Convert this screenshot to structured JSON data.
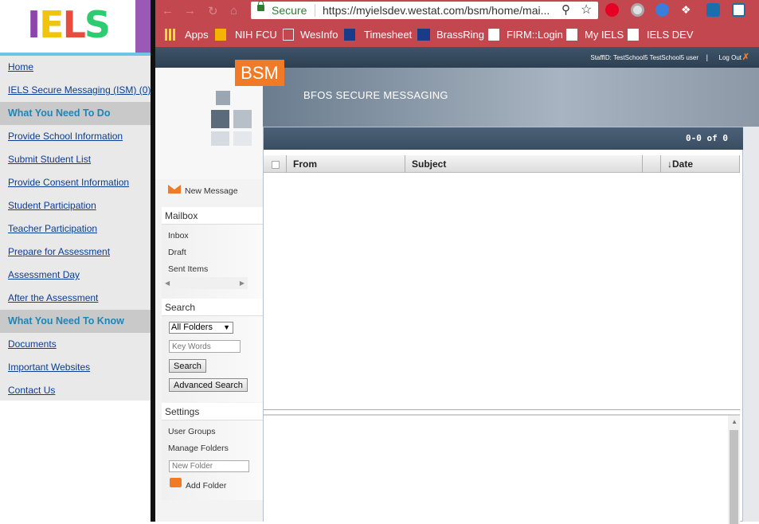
{
  "iels": {
    "logo": "IELS",
    "nav": [
      {
        "type": "link",
        "label": "Home"
      },
      {
        "type": "link",
        "label": "IELS Secure Messaging (ISM) (0)"
      },
      {
        "type": "head",
        "label": "What You Need To Do"
      },
      {
        "type": "link",
        "label": "Provide School Information"
      },
      {
        "type": "link",
        "label": "Submit Student List"
      },
      {
        "type": "link",
        "label": "Provide Consent Information"
      },
      {
        "type": "link",
        "label": "Student Participation"
      },
      {
        "type": "link",
        "label": "Teacher Participation"
      },
      {
        "type": "link",
        "label": "Prepare for Assessment"
      },
      {
        "type": "link",
        "label": "Assessment Day"
      },
      {
        "type": "link",
        "label": "After the Assessment"
      },
      {
        "type": "head",
        "label": "What You Need To Know"
      },
      {
        "type": "link",
        "label": "Documents"
      },
      {
        "type": "link",
        "label": "Important Websites"
      },
      {
        "type": "link",
        "label": "Contact Us"
      }
    ]
  },
  "browser": {
    "secure_label": "Secure",
    "url": "https://myielsdev.westat.com/bsm/home/mai...",
    "bookmarks": [
      {
        "label": "Apps"
      },
      {
        "label": "NIH FCU"
      },
      {
        "label": "WesInfo"
      },
      {
        "label": "Timesheet"
      },
      {
        "label": "BrassRing"
      },
      {
        "label": "FIRM::Login"
      },
      {
        "label": "My IELS"
      },
      {
        "label": "IELS DEV"
      }
    ]
  },
  "app": {
    "staff_info": "StaffID: TestSchool5  TestSchool5 user",
    "separator": "|",
    "logout": "Log Out",
    "badge": "BSM",
    "title": "BFOS SECURE MESSAGING",
    "count": "0-0 of 0",
    "new_message": "New Message",
    "mailbox_head": "Mailbox",
    "mailbox_items": [
      "Inbox",
      "Draft",
      "Sent Items"
    ],
    "search_head": "Search",
    "folder_select": "All Folders",
    "keywords_placeholder": "Key Words",
    "search_button": "Search",
    "advanced_search_button": "Advanced Search",
    "settings_head": "Settings",
    "user_groups": "User Groups",
    "manage_folders": "Manage Folders",
    "new_folder_placeholder": "New Folder",
    "add_folder": "Add Folder",
    "columns": {
      "from": "From",
      "subject": "Subject",
      "date": "↓Date"
    }
  }
}
